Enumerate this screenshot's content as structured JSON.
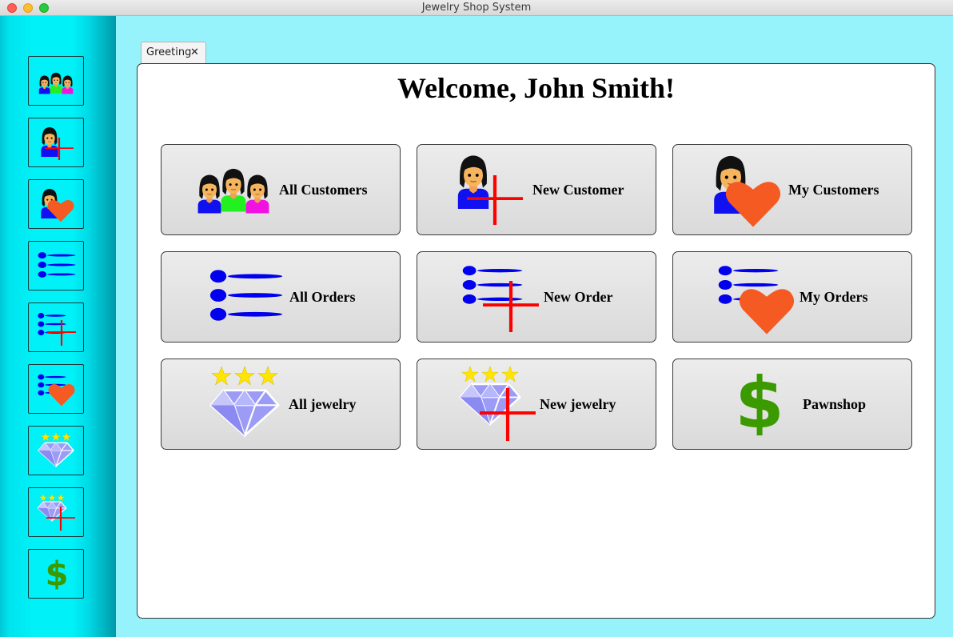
{
  "window": {
    "title": "Jewelry Shop System"
  },
  "tabs": [
    {
      "label": "Greeting",
      "close_glyph": "✕"
    }
  ],
  "greeting": {
    "welcome": "Welcome, John Smith!"
  },
  "sidebar": {
    "items": [
      {
        "icon": "customers-group-icon"
      },
      {
        "icon": "new-customer-icon"
      },
      {
        "icon": "my-customers-icon"
      },
      {
        "icon": "orders-list-icon"
      },
      {
        "icon": "new-order-icon"
      },
      {
        "icon": "my-orders-icon"
      },
      {
        "icon": "jewelry-diamond-icon"
      },
      {
        "icon": "new-jewelry-icon"
      },
      {
        "icon": "pawnshop-dollar-icon"
      }
    ]
  },
  "menu": {
    "all_customers": "All Customers",
    "new_customer": "New Customer",
    "my_customers": "My Customers",
    "all_orders": "All Orders",
    "new_order": "New Order",
    "my_orders": "My Orders",
    "all_jewelry": "All jewelry",
    "new_jewelry": "New jewelry",
    "pawnshop": "Pawnshop"
  },
  "colors": {
    "background": "#96f2fb",
    "sidebar": "#00f2f8",
    "list_blue": "#0000ee",
    "heart": "#f55a22",
    "plus_red": "#ff0000",
    "dollar_green": "#3a9a00",
    "star_yellow": "#ffe600",
    "diamond": "#9c9cf6"
  }
}
